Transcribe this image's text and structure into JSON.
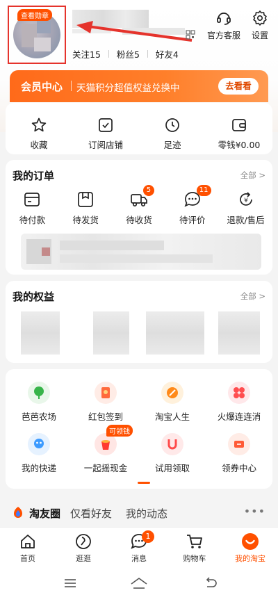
{
  "profile": {
    "medal_label": "查看勋章",
    "stats": [
      {
        "label": "关注",
        "value": "15"
      },
      {
        "label": "粉丝",
        "value": "5"
      },
      {
        "label": "好友",
        "value": "4"
      }
    ]
  },
  "top_actions": {
    "service_label": "官方客服",
    "settings_label": "设置"
  },
  "member": {
    "title": "会员中心",
    "desc": "天猫积分超值权益兑换中",
    "button": "去看看"
  },
  "quick": [
    {
      "label": "收藏",
      "icon": "star-icon"
    },
    {
      "label": "订阅店铺",
      "icon": "subscribe-store-icon"
    },
    {
      "label": "足迹",
      "icon": "clock-icon"
    },
    {
      "label": "零钱¥0.00",
      "icon": "wallet-icon"
    }
  ],
  "orders": {
    "title": "我的订单",
    "more": "全部 >",
    "items": [
      {
        "label": "待付款",
        "icon": "card-icon",
        "badge": ""
      },
      {
        "label": "待发货",
        "icon": "box-icon",
        "badge": ""
      },
      {
        "label": "待收货",
        "icon": "truck-icon",
        "badge": "5"
      },
      {
        "label": "待评价",
        "icon": "comment-icon",
        "badge": "11"
      },
      {
        "label": "退款/售后",
        "icon": "refund-icon",
        "badge": ""
      }
    ]
  },
  "rights": {
    "title": "我的权益",
    "more": "全部 >"
  },
  "apps": [
    {
      "label": "芭芭农场",
      "icon": "farm-icon",
      "color": "#37b44a",
      "badge": ""
    },
    {
      "label": "红包签到",
      "icon": "red-packet-icon",
      "color": "#ff6a3c",
      "badge": ""
    },
    {
      "label": "淘宝人生",
      "icon": "taobao-life-icon",
      "color": "#ff8a1a",
      "badge": ""
    },
    {
      "label": "火爆连连消",
      "icon": "match-game-icon",
      "color": "#ff4d4f",
      "badge": ""
    },
    {
      "label": "我的快递",
      "icon": "express-icon",
      "color": "#3d9bff",
      "badge": ""
    },
    {
      "label": "一起摇现金",
      "icon": "shake-cash-icon",
      "color": "#ff3b30",
      "badge": "可领钱"
    },
    {
      "label": "试用领取",
      "icon": "trial-icon",
      "color": "#ff4a4a",
      "badge": ""
    },
    {
      "label": "领券中心",
      "icon": "coupon-icon",
      "color": "#ff5a36",
      "badge": ""
    }
  ],
  "feed": {
    "tabs": [
      "淘友圈",
      "仅看好友",
      "我的动态"
    ],
    "more": "•••"
  },
  "tabbar": [
    {
      "label": "首页",
      "icon": "home-icon"
    },
    {
      "label": "逛逛",
      "icon": "stroll-icon"
    },
    {
      "label": "消息",
      "icon": "message-icon",
      "badge": "1"
    },
    {
      "label": "购物车",
      "icon": "cart-icon"
    },
    {
      "label": "我的淘宝",
      "icon": "my-taobao-icon"
    }
  ],
  "colors": {
    "accent": "#ff5000",
    "highlight_box": "#e5332c"
  }
}
